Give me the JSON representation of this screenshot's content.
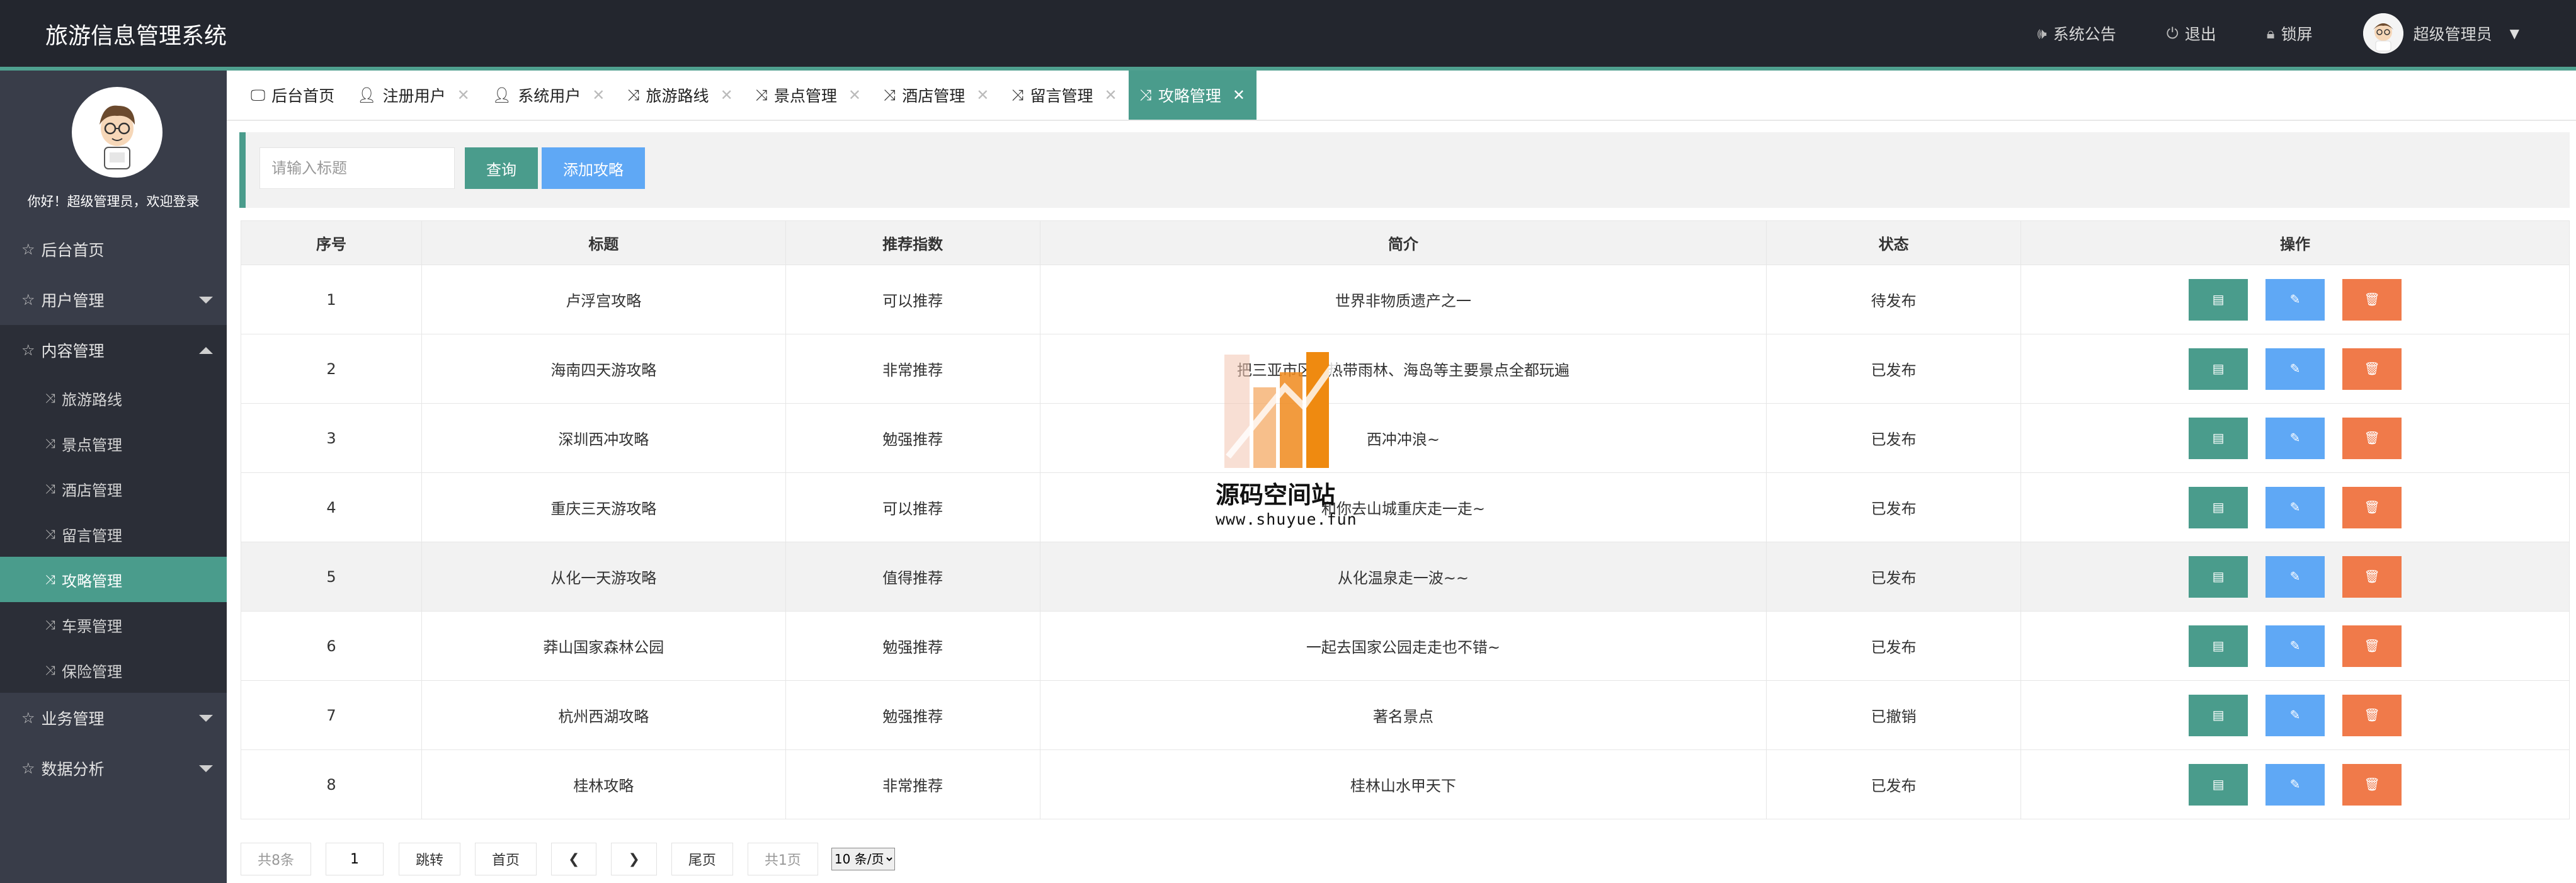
{
  "header": {
    "title": "旅游信息管理系统",
    "notice_label": "系统公告",
    "logout_label": "退出",
    "lock_label": "锁屏",
    "user_label": "超级管理员"
  },
  "sidebar": {
    "welcome": "你好！超级管理员，欢迎登录",
    "items": [
      {
        "label": "后台首页"
      },
      {
        "label": "用户管理"
      },
      {
        "label": "内容管理"
      }
    ],
    "sub_items": [
      {
        "label": "旅游路线"
      },
      {
        "label": "景点管理"
      },
      {
        "label": "酒店管理"
      },
      {
        "label": "留言管理"
      },
      {
        "label": "攻略管理"
      },
      {
        "label": "车票管理"
      },
      {
        "label": "保险管理"
      }
    ],
    "bottom_items": [
      {
        "label": "业务管理"
      },
      {
        "label": "数据分析"
      }
    ]
  },
  "tabs": [
    {
      "label": "后台首页"
    },
    {
      "label": "注册用户"
    },
    {
      "label": "系统用户"
    },
    {
      "label": "旅游路线"
    },
    {
      "label": "景点管理"
    },
    {
      "label": "酒店管理"
    },
    {
      "label": "留言管理"
    },
    {
      "label": "攻略管理"
    }
  ],
  "search": {
    "placeholder": "请输入标题",
    "query_label": "查询",
    "add_label": "添加攻略"
  },
  "table": {
    "columns": [
      "序号",
      "标题",
      "推荐指数",
      "简介",
      "状态",
      "操作"
    ],
    "rows": [
      {
        "no": "1",
        "title": "卢浮宫攻略",
        "rating": "可以推荐",
        "intro": "世界非物质遗产之一",
        "status": "待发布"
      },
      {
        "no": "2",
        "title": "海南四天游攻略",
        "rating": "非常推荐",
        "intro": "把三亚市区和热带雨林、海岛等主要景点全都玩遍",
        "status": "已发布"
      },
      {
        "no": "3",
        "title": "深圳西冲攻略",
        "rating": "勉强推荐",
        "intro": "西冲冲浪~",
        "status": "已发布"
      },
      {
        "no": "4",
        "title": "重庆三天游攻略",
        "rating": "可以推荐",
        "intro": "和你去山城重庆走一走~",
        "status": "已发布"
      },
      {
        "no": "5",
        "title": "从化一天游攻略",
        "rating": "值得推荐",
        "intro": "从化温泉走一波~~",
        "status": "已发布"
      },
      {
        "no": "6",
        "title": "莽山国家森林公园",
        "rating": "勉强推荐",
        "intro": "一起去国家公园走走也不错~",
        "status": "已发布"
      },
      {
        "no": "7",
        "title": "杭州西湖攻略",
        "rating": "勉强推荐",
        "intro": "著名景点",
        "status": "已撤销"
      },
      {
        "no": "8",
        "title": "桂林攻略",
        "rating": "非常推荐",
        "intro": "桂林山水甲天下",
        "status": "已发布"
      }
    ]
  },
  "pagination": {
    "total": "共8条",
    "page": "1",
    "jump": "跳转",
    "first": "首页",
    "prev": "❮",
    "next": "❯",
    "last": "尾页",
    "pages": "共1页",
    "per_page": "10 条/页"
  },
  "watermark": {
    "name": "源码空间站",
    "url": "www.shuyue.fun"
  },
  "colors": {
    "accent": "#4a9c8c",
    "header_bg": "#23262e",
    "sidebar_bg": "#393d49",
    "edit_btn": "#5fa8f5",
    "delete_btn": "#f07a4a"
  }
}
